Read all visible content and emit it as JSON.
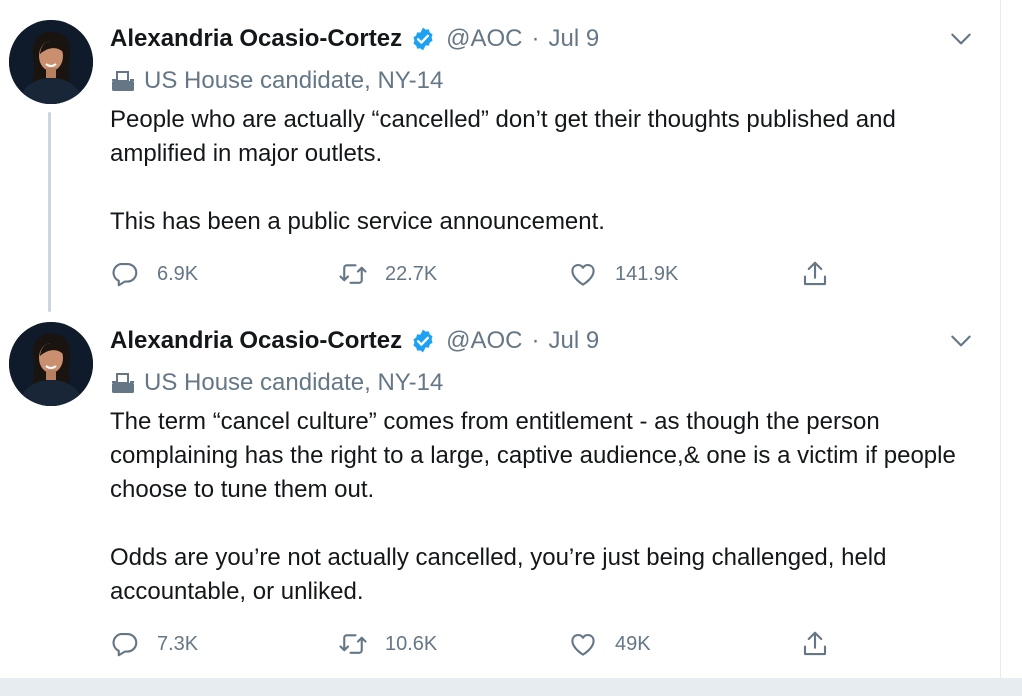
{
  "tweets": [
    {
      "author": "Alexandria Ocasio-Cortez",
      "handle": "@AOC",
      "separator": "·",
      "date": "Jul 9",
      "label": "US House candidate, NY-14",
      "body": [
        "People who are actually “cancelled” don’t get their thoughts published and amplified in major outlets.",
        "This has been a public service announcement."
      ],
      "replies": "6.9K",
      "retweets": "22.7K",
      "likes": "141.9K"
    },
    {
      "author": "Alexandria Ocasio-Cortez",
      "handle": "@AOC",
      "separator": "·",
      "date": "Jul 9",
      "label": "US House candidate, NY-14",
      "body": [
        "The term “cancel culture” comes from entitlement - as though the person complaining has the right to a large, captive audience,& one is a victim if people choose to tune them out.",
        "Odds are you’re not actually cancelled, you’re just being challenged, held accountable, or unliked."
      ],
      "replies": "7.3K",
      "retweets": "10.6K",
      "likes": "49K"
    }
  ],
  "icons": {
    "verified": "verified-badge-icon",
    "caret": "chevron-down-icon",
    "label": "ballot-box-icon",
    "reply": "reply-icon",
    "retweet": "retweet-icon",
    "like": "heart-icon",
    "share": "share-icon"
  },
  "colors": {
    "verified": "#1da1f2",
    "text": "#14171a",
    "secondary": "#657786",
    "thread_line": "#ccd6dd",
    "background_band": "#e6ecf0"
  }
}
